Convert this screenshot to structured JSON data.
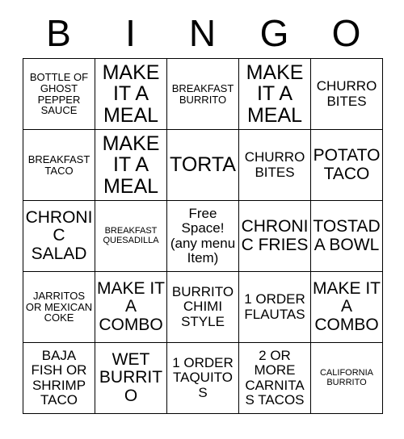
{
  "header": {
    "letters": [
      "B",
      "I",
      "N",
      "G",
      "O"
    ]
  },
  "grid": {
    "rows": [
      [
        {
          "text": "BOTTLE OF GHOST PEPPER SAUCE",
          "size": "sm"
        },
        {
          "text": "MAKE IT A MEAL",
          "size": "xl"
        },
        {
          "text": "BREAKFAST BURRITO",
          "size": "sm"
        },
        {
          "text": "MAKE IT A MEAL",
          "size": "xl"
        },
        {
          "text": "CHURRO BITES",
          "size": "md"
        }
      ],
      [
        {
          "text": "BREAKFAST TACO",
          "size": "sm"
        },
        {
          "text": "MAKE IT A MEAL",
          "size": "xl"
        },
        {
          "text": "TORTA",
          "size": "xl"
        },
        {
          "text": "CHURRO BITES",
          "size": "md"
        },
        {
          "text": "POTATO TACO",
          "size": "lg"
        }
      ],
      [
        {
          "text": "CHRONIC SALAD",
          "size": "lg"
        },
        {
          "text": "BREAKFAST QUESADILLA",
          "size": "xs"
        },
        {
          "text": "Free Space! (any menu Item)",
          "size": "md"
        },
        {
          "text": "CHRONIC FRIES",
          "size": "lg"
        },
        {
          "text": "TOSTADA BOWL",
          "size": "lg"
        }
      ],
      [
        {
          "text": "JARRITOS OR MEXICAN COKE",
          "size": "sm"
        },
        {
          "text": "MAKE IT A COMBO",
          "size": "lg"
        },
        {
          "text": "BURRITO CHIMI STYLE",
          "size": "md"
        },
        {
          "text": "1 ORDER FLAUTAS",
          "size": "md"
        },
        {
          "text": "MAKE IT A COMBO",
          "size": "lg"
        }
      ],
      [
        {
          "text": "BAJA FISH OR SHRIMP TACO",
          "size": "md"
        },
        {
          "text": "WET BURRITO",
          "size": "lg"
        },
        {
          "text": "1 ORDER TAQUITOS",
          "size": "md"
        },
        {
          "text": "2 OR MORE CARNITAS TACOS",
          "size": "md"
        },
        {
          "text": "CALIFORNIA BURRITO",
          "size": "xs"
        }
      ]
    ]
  },
  "colors": {
    "background": "#ffffff",
    "text": "#000000",
    "border": "#000000"
  }
}
